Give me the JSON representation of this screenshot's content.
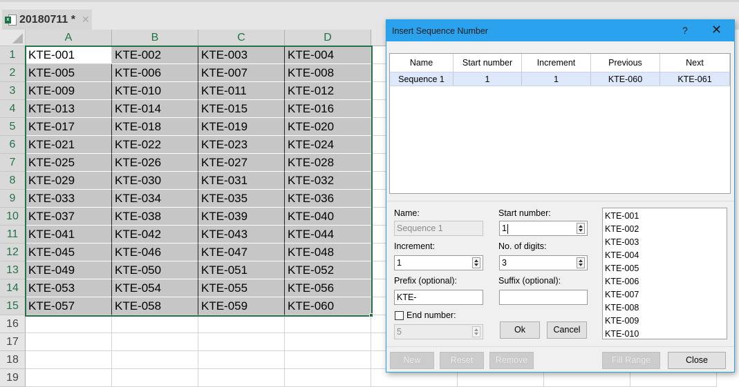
{
  "workbook_tab": {
    "title": "20180711 *",
    "icon": "excel-file-icon",
    "close_icon": "close-icon"
  },
  "columns": [
    "A",
    "B",
    "C",
    "D"
  ],
  "rows": [
    [
      "KTE-001",
      "KTE-002",
      "KTE-003",
      "KTE-004"
    ],
    [
      "KTE-005",
      "KTE-006",
      "KTE-007",
      "KTE-008"
    ],
    [
      "KTE-009",
      "KTE-010",
      "KTE-011",
      "KTE-012"
    ],
    [
      "KTE-013",
      "KTE-014",
      "KTE-015",
      "KTE-016"
    ],
    [
      "KTE-017",
      "KTE-018",
      "KTE-019",
      "KTE-020"
    ],
    [
      "KTE-021",
      "KTE-022",
      "KTE-023",
      "KTE-024"
    ],
    [
      "KTE-025",
      "KTE-026",
      "KTE-027",
      "KTE-028"
    ],
    [
      "KTE-029",
      "KTE-030",
      "KTE-031",
      "KTE-032"
    ],
    [
      "KTE-033",
      "KTE-034",
      "KTE-035",
      "KTE-036"
    ],
    [
      "KTE-037",
      "KTE-038",
      "KTE-039",
      "KTE-040"
    ],
    [
      "KTE-041",
      "KTE-042",
      "KTE-043",
      "KTE-044"
    ],
    [
      "KTE-045",
      "KTE-046",
      "KTE-047",
      "KTE-048"
    ],
    [
      "KTE-049",
      "KTE-050",
      "KTE-051",
      "KTE-052"
    ],
    [
      "KTE-053",
      "KTE-054",
      "KTE-055",
      "KTE-056"
    ],
    [
      "KTE-057",
      "KTE-058",
      "KTE-059",
      "KTE-060"
    ]
  ],
  "row_numbers": [
    "1",
    "2",
    "3",
    "4",
    "5",
    "6",
    "7",
    "8",
    "9",
    "10",
    "11",
    "12",
    "13",
    "14",
    "15",
    "16",
    "17",
    "18",
    "19"
  ],
  "selected_range": "A1:D15",
  "colors": {
    "accent_green": "#217346",
    "dialog_title": "#2ba2ee",
    "selected_row": "#dde8fa"
  },
  "dialog": {
    "title": "Insert Sequence Number",
    "help": "?",
    "close": "✕",
    "table": {
      "headers": [
        "Name",
        "Start number",
        "Increment",
        "Previous",
        "Next"
      ],
      "rows": [
        [
          "Sequence 1",
          "1",
          "1",
          "KTE-060",
          "KTE-061"
        ]
      ]
    },
    "form": {
      "name_label": "Name:",
      "name_value": "Sequence 1",
      "start_label": "Start number:",
      "start_value": "1",
      "increment_label": "Increment:",
      "increment_value": "1",
      "digits_label": "No. of digits:",
      "digits_value": "3",
      "prefix_label": "Prefix (optional):",
      "prefix_value": "KTE-",
      "suffix_label": "Suffix (optional):",
      "suffix_value": "",
      "end_label": "End number:",
      "end_checked": false,
      "end_value": "5"
    },
    "preview": [
      "KTE-001",
      "KTE-002",
      "KTE-003",
      "KTE-004",
      "KTE-005",
      "KTE-006",
      "KTE-007",
      "KTE-008",
      "KTE-009",
      "KTE-010"
    ],
    "buttons": {
      "ok": "Ok",
      "cancel": "Cancel",
      "new": "New",
      "reset": "Reset",
      "remove": "Remove",
      "fill_range": "Fill Range",
      "close": "Close"
    }
  }
}
